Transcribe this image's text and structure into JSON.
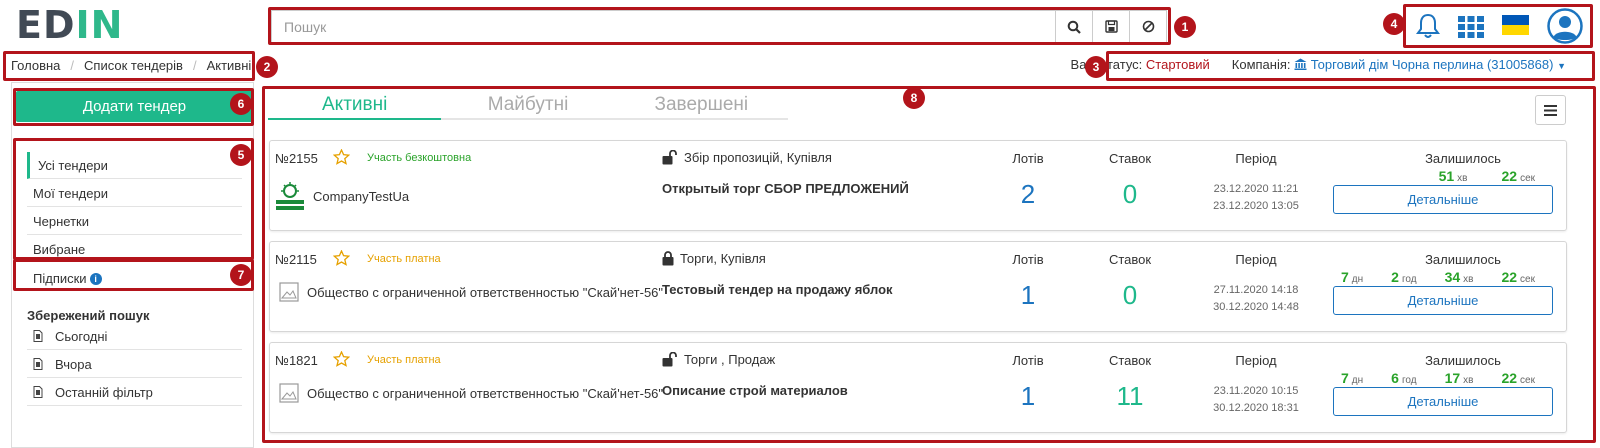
{
  "header": {
    "logo_text_left": "ED",
    "logo_text_right": "IN",
    "search_placeholder": "Пошук",
    "icons": [
      "search-icon",
      "save-icon",
      "clear-icon",
      "bell-icon",
      "apps-grid-icon",
      "flag-ua-icon",
      "user-avatar-icon"
    ]
  },
  "breadcrumb": {
    "items": [
      "Головна",
      "Список тендерів",
      "Активні"
    ]
  },
  "status": {
    "status_label": "Ваш статус:",
    "status_value": "Стартовий",
    "company_label": "Компанія:",
    "company_value": "Торговий дім Чорна перлина (31005868)"
  },
  "sidebar": {
    "add_button": "Додати тендер",
    "menu": [
      "Усі тендери",
      "Мої тендери",
      "Чернетки",
      "Вибране"
    ],
    "subscriptions": "Підписки",
    "saved_search_title": "Збережений пошук",
    "saved": [
      "Сьогодні",
      "Вчора",
      "Останній фільтр"
    ]
  },
  "tabs": [
    "Активні",
    "Майбутні",
    "Завершені"
  ],
  "badges": [
    "1",
    "2",
    "3",
    "4",
    "5",
    "6",
    "7",
    "8"
  ],
  "colors": {
    "accent": "#1eb88b",
    "annotation": "#b3141b",
    "link": "#1c74bf",
    "timer": "#2aa32a"
  },
  "labels": {
    "lots": "Лотів",
    "bids": "Ставок",
    "period": "Період",
    "remaining": "Залишилось",
    "details": "Детальніше"
  },
  "tenders": [
    {
      "number": "№2155",
      "participation": "Участь безкоштовна",
      "participation_color": "#2aa32a",
      "company": "CompanyTestUa",
      "method": "Збір пропозицій, Купівля",
      "lock": "open",
      "title": "Открытый торг СБОР ПРЕДЛОЖЕНИЙ",
      "lots": "2",
      "bids": "0",
      "date_from": "23.12.2020 11:21",
      "date_to": "23.12.2020 13:05",
      "remaining": [
        {
          "value": "51",
          "unit": "хв"
        },
        {
          "value": "22",
          "unit": "сек"
        }
      ]
    },
    {
      "number": "№2115",
      "participation": "Участь платна",
      "participation_color": "#e6a100",
      "company": "Общество с ограниченной ответственностью \"Скай'нет-56\"",
      "method": "Торги, Купівля",
      "lock": "closed",
      "title": "Тестовый тендер на продажу яблок",
      "lots": "1",
      "bids": "0",
      "date_from": "27.11.2020 14:18",
      "date_to": "30.12.2020 14:48",
      "remaining": [
        {
          "value": "7",
          "unit": "дн"
        },
        {
          "value": "2",
          "unit": "год"
        },
        {
          "value": "34",
          "unit": "хв"
        },
        {
          "value": "22",
          "unit": "сек"
        }
      ]
    },
    {
      "number": "№1821",
      "participation": "Участь платна",
      "participation_color": "#e6a100",
      "company": "Общество с ограниченной ответственностью \"Скай'нет-56\"",
      "method": "Торги , Продаж",
      "lock": "open",
      "title": "Описание строй материалов",
      "lots": "1",
      "bids": "11",
      "date_from": "23.11.2020 10:15",
      "date_to": "30.12.2020 18:31",
      "remaining": [
        {
          "value": "7",
          "unit": "дн"
        },
        {
          "value": "6",
          "unit": "год"
        },
        {
          "value": "17",
          "unit": "хв"
        },
        {
          "value": "22",
          "unit": "сек"
        }
      ]
    }
  ]
}
